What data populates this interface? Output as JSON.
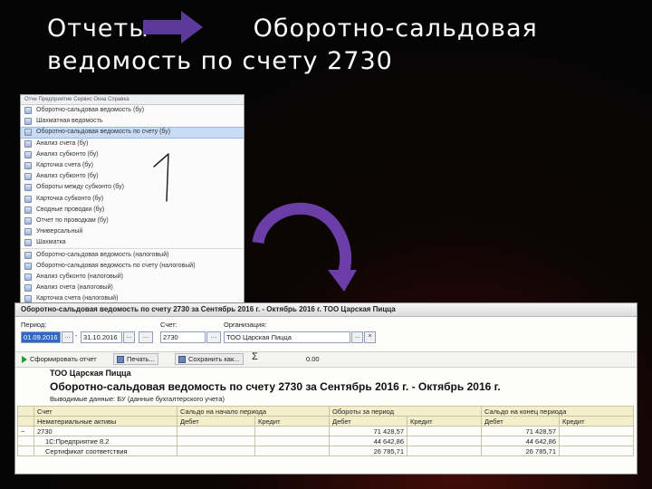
{
  "slide": {
    "title_line1": "Отчеты            Оборотно-сальдовая",
    "title_line2": "ведомость по счету 2730",
    "hand_number": "1"
  },
  "menu": {
    "bar": "Отче   Предприятие   Сервис   Окна   Справка",
    "items": [
      {
        "label": "Оборотно-сальдовая ведомость (бу)"
      },
      {
        "label": "Шахматная ведомость"
      },
      {
        "label": "Оборотно-сальдовая ведомость по счету (бу)"
      },
      {
        "label": "Анализ счета (бу)"
      },
      {
        "label": "Анализ субконто (бу)"
      },
      {
        "label": "Карточка счета (бу)"
      },
      {
        "label": "Анализ субконто (бу)"
      },
      {
        "label": "Обороты между субконто (бу)"
      },
      {
        "label": "Карточка субконто (бу)"
      },
      {
        "label": "Сводные проводки (бу)"
      },
      {
        "label": "Отчет по проводкам (бу)"
      },
      {
        "label": "Универсальный"
      },
      {
        "label": "Шахматка"
      },
      {
        "label": "Оборотно-сальдовая ведомость (налоговый)"
      },
      {
        "label": "Оборотно-сальдовая ведомость по счету (налоговый)"
      },
      {
        "label": "Анализ субконто (налоговый)"
      },
      {
        "label": "Анализ счета (налоговый)"
      },
      {
        "label": "Карточка счета (налоговый)"
      }
    ]
  },
  "report": {
    "window_title": "Оборотно-сальдовая ведомость по счету 2730 за Сентябрь 2016 г. - Октябрь 2016 г. ТОО Царская Пицца",
    "period_label": "Период:",
    "period_from": "01.09.2016",
    "period_to": "31.10.2016",
    "account_label": "Счет:",
    "account_value": "2730",
    "org_label": "Организация:",
    "org_value": "ТОО Царская Пицца",
    "btn_generate": "Сформировать отчет",
    "btn_print": "Печать...",
    "btn_save": "Сохранить как...",
    "sigma_value": "0.00",
    "org_name": "ТОО Царская Пицца",
    "heading": "Оборотно-сальдовая ведомость по счету 2730 за Сентябрь 2016 г. - Октябрь 2016 г.",
    "subheading": "Выводимые данные: БУ (данные бухгалтерского учета)",
    "columns": {
      "account": "Счет",
      "assets": "Нематериальные активы",
      "open_balance": "Сальдо на начало периода",
      "turnover": "Обороты за период",
      "close_balance": "Сальдо на конец периода",
      "debit": "Дебет",
      "credit": "Кредит"
    },
    "rows": [
      {
        "mark": "−",
        "name": "2730",
        "o_d": "",
        "o_c": "",
        "t_d": "71 428,57",
        "t_c": "",
        "c_d": "71 428,57",
        "c_c": ""
      },
      {
        "mark": "",
        "name": "1С:Предприятие 8.2",
        "o_d": "",
        "o_c": "",
        "t_d": "44 642,86",
        "t_c": "",
        "c_d": "44 642,86",
        "c_c": ""
      },
      {
        "mark": "",
        "name": "Сертификат соответствия",
        "o_d": "",
        "o_c": "",
        "t_d": "26 785,71",
        "t_c": "",
        "c_d": "26 785,71",
        "c_c": ""
      }
    ]
  },
  "colors": {
    "background": "#050505",
    "arrow": "#6a3ea6",
    "selection": "#c9dcf6",
    "table_header": "#f3eecb"
  }
}
